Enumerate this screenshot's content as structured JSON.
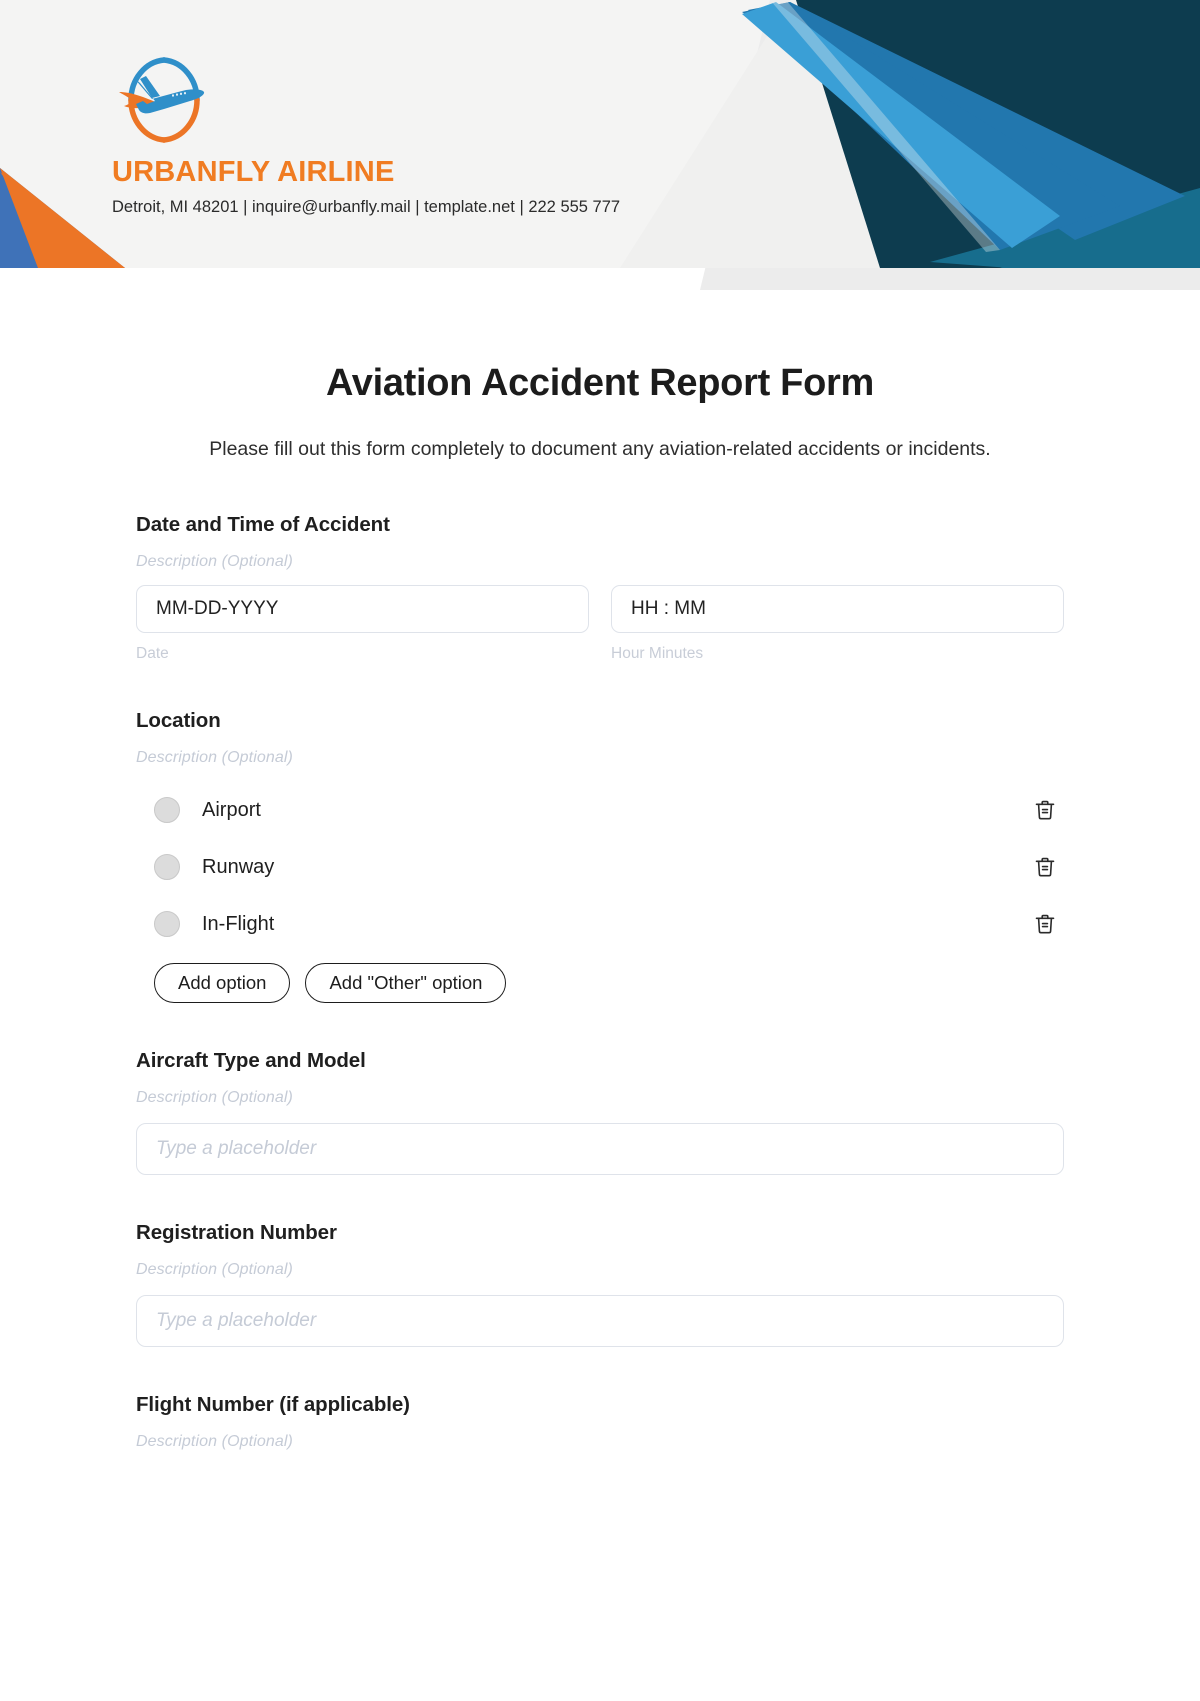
{
  "brand": {
    "name": "URBANFLY AIRLINE",
    "contact": "Detroit, MI 48201 | inquire@urbanfly.mail | template.net | 222 555 777",
    "logo_icon": "airplane-in-circle-logo",
    "accent_orange": "#f07c22",
    "accent_blue": "#3a9fd6",
    "accent_navy": "#0d3c4f",
    "header_bg": "#f4f4f3"
  },
  "form": {
    "title": "Aviation Accident Report Form",
    "subtitle": "Please fill out this form completely to document any aviation-related accidents or incidents.",
    "description_placeholder": "Description (Optional)",
    "text_placeholder": "Type a placeholder",
    "sections": {
      "datetime": {
        "label": "Date and Time of Accident",
        "description": "Description (Optional)",
        "date_value": "MM-DD-YYYY",
        "date_sublabel": "Date",
        "time_value": "HH : MM",
        "time_sublabel": "Hour Minutes"
      },
      "location": {
        "label": "Location",
        "description": "Description (Optional)",
        "options": [
          {
            "label": "Airport",
            "delete_icon": "trash-icon"
          },
          {
            "label": "Runway",
            "delete_icon": "trash-icon"
          },
          {
            "label": "In-Flight",
            "delete_icon": "trash-icon"
          }
        ],
        "add_option_label": "Add option",
        "add_other_option_label": "Add \"Other\" option"
      },
      "aircraft": {
        "label": "Aircraft Type and Model",
        "description": "Description (Optional)",
        "placeholder": "Type a placeholder"
      },
      "registration": {
        "label": "Registration Number",
        "description": "Description (Optional)",
        "placeholder": "Type a placeholder"
      },
      "flight_number": {
        "label": "Flight Number (if applicable)",
        "description": "Description (Optional)"
      }
    }
  }
}
